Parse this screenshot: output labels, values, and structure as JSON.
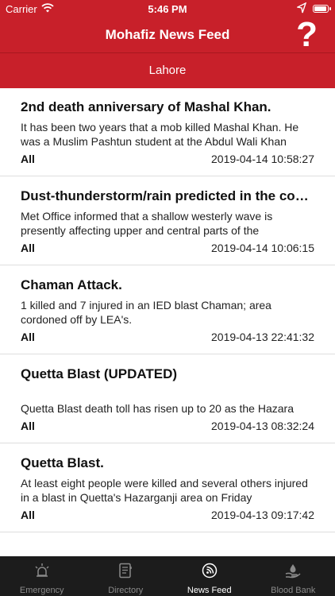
{
  "status_bar": {
    "carrier": "Carrier",
    "time": "5:46 PM"
  },
  "nav": {
    "title": "Mohafiz News Feed",
    "help_glyph": "?"
  },
  "city": "Lahore",
  "news": [
    {
      "headline": "2nd death anniversary of Mashal Khan.",
      "summary": "It has been two years that a mob killed Mashal Khan. He was a Muslim Pashtun student at the Abdul Wali Khan",
      "tag": "All",
      "timestamp": "2019-04-14 10:58:27"
    },
    {
      "headline": "Dust-thunderstorm/rain predicted in the cou...",
      "summary": "Met Office informed that a shallow westerly wave is presently affecting upper and central parts of the",
      "tag": "All",
      "timestamp": "2019-04-14 10:06:15"
    },
    {
      "headline": "Chaman Attack.",
      "summary": "1 killed and 7 injured in an IED blast Chaman; area cordoned off by LEA's.",
      "tag": "All",
      "timestamp": "2019-04-13 22:41:32"
    },
    {
      "headline": "Quetta Blast (UPDATED)",
      "summary": "Quetta Blast death toll has risen up to 20 as the Hazara",
      "tag": "All",
      "timestamp": "2019-04-13 08:32:24"
    },
    {
      "headline": "Quetta Blast.",
      "summary": "At least eight people were killed and several others injured in a blast in Quetta's Hazarganji area on Friday",
      "tag": "All",
      "timestamp": "2019-04-13 09:17:42"
    }
  ],
  "tabs": [
    {
      "label": "Emergency",
      "icon": "siren-icon"
    },
    {
      "label": "Directory",
      "icon": "directory-icon"
    },
    {
      "label": "News Feed",
      "icon": "news-feed-icon",
      "active": true
    },
    {
      "label": "Blood Bank",
      "icon": "blood-bank-icon"
    }
  ],
  "colors": {
    "brand_red": "#c8202a",
    "tabbar_bg": "#1c1c1c",
    "tab_inactive": "#8a8a8a",
    "tab_active": "#ffffff"
  }
}
